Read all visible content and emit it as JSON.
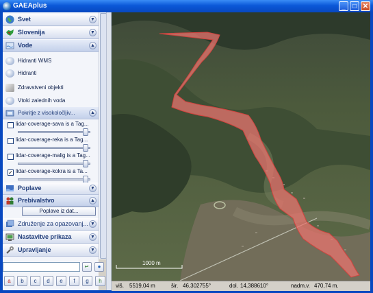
{
  "window": {
    "title": "GAEAplus",
    "minimize": "_",
    "maximize": "□",
    "close": "✕"
  },
  "sidebar": {
    "sections": [
      {
        "label": "Svet",
        "icon": "globe-icon"
      },
      {
        "label": "Slovenija",
        "icon": "slovenia-map-icon"
      },
      {
        "label": "Vode",
        "icon": "water-icon"
      }
    ],
    "vode_items": [
      {
        "label": "Hidranti WMS",
        "icon": "hydrant-wms-icon"
      },
      {
        "label": "Hidranti",
        "icon": "hydrant-icon"
      },
      {
        "label": "Zdravstveni objekti",
        "icon": "health-facility-icon"
      },
      {
        "label": "Vtoki zalednih voda",
        "icon": "inflow-icon"
      }
    ],
    "coverage_header": "Pokritje z visokoločljiv...",
    "layers": [
      {
        "label": "lidar-coverage-sava is a Tag...",
        "checked": false,
        "opacity": 1.0
      },
      {
        "label": "lidar-coverage-reka is a Tag...",
        "checked": false,
        "opacity": 1.0
      },
      {
        "label": "lidar-coverage-malig is a Tag...",
        "checked": false,
        "opacity": 1.0
      },
      {
        "label": "lidar-coverage-kokra is a Ta...",
        "checked": true,
        "opacity": 1.0
      }
    ],
    "poplave_header": "Poplave",
    "prebivalstvo_header": "Prebivalstvo",
    "poplave_button": "Poplave iz dat...",
    "lower_sections": [
      {
        "label": "Združenje za opazovanj...",
        "icon": "observation-icon"
      },
      {
        "label": "Nastavitve prikaza",
        "icon": "display-settings-icon"
      },
      {
        "label": "Upravljanje",
        "icon": "management-icon"
      }
    ],
    "search": {
      "value": "",
      "go": "↵",
      "globe": "●"
    },
    "toolbar": [
      "a",
      "b",
      "c",
      "d",
      "e",
      "f",
      "g",
      "h"
    ]
  },
  "map": {
    "scale_label": "1000 m",
    "overlay_color": "#e8746f",
    "status": {
      "visina_label": "viš.",
      "visina": "5519,04 m",
      "sirina_label": "šir.",
      "sirina": "46,302755°",
      "dolzina_label": "dol.",
      "dolzina": "14,388610°",
      "nadm_label": "nadm.v.",
      "nadm": "470,74 m."
    }
  }
}
